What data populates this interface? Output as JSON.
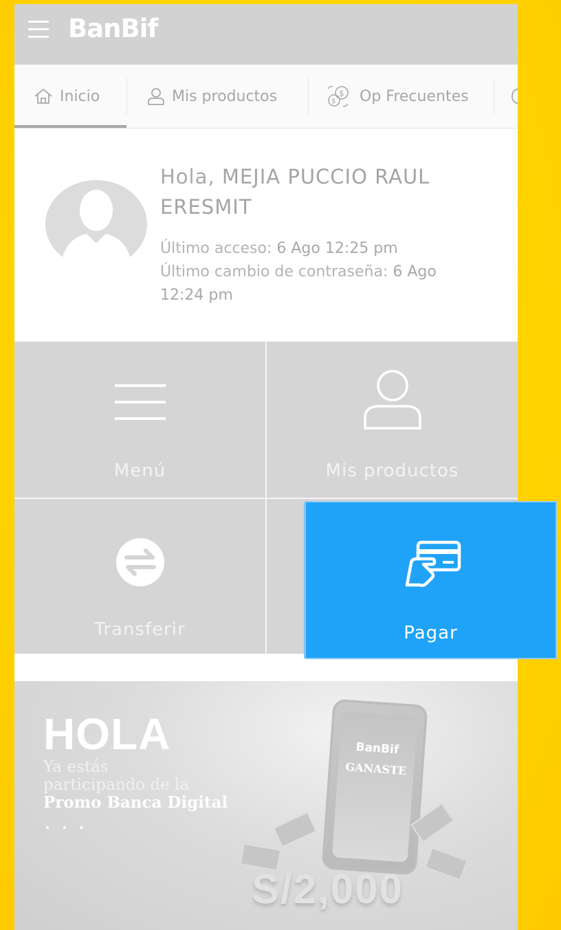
{
  "header": {
    "logo": "BanBif"
  },
  "tabs": [
    {
      "label": "Inicio",
      "icon": "home-icon"
    },
    {
      "label": "Mis productos",
      "icon": "user-icon"
    },
    {
      "label": "Op Frecuentes",
      "icon": "coins-icon"
    },
    {
      "label": "",
      "icon": "partial-icon"
    }
  ],
  "welcome": {
    "greeting_prefix": "Hola,",
    "name_line1": "MEJIA PUCCIO RAUL",
    "name_line2": "ERESMIT",
    "last_access_label": "Último acceso:",
    "last_access_value": "6 Ago 12:25 pm",
    "last_pwd_label": "Último cambio de contraseña:",
    "last_pwd_value": "6 Ago 12:24 pm"
  },
  "tiles": {
    "menu": "Menú",
    "mis_productos": "Mis productos",
    "transferir": "Transferir",
    "pagar": "Pagar"
  },
  "promo": {
    "title": "HOLA",
    "line1": "Ya estás",
    "line2": "participando de la",
    "line3": "Promo Banca Digital",
    "dots": "• • •",
    "phone_logo": "BanBif",
    "phone_text": "GANASTE",
    "amount": "S/2,000"
  },
  "colors": {
    "highlight": "#1FA3F8",
    "background": "#FFD500"
  }
}
